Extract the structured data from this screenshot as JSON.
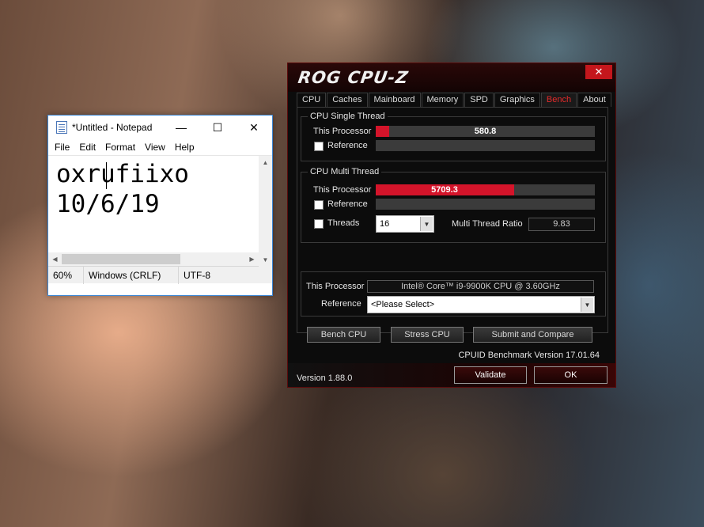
{
  "notepad": {
    "title": "*Untitled - Notepad",
    "window_controls": {
      "minimize": "—",
      "maximize": "☐",
      "close": "✕"
    },
    "menu": [
      "File",
      "Edit",
      "Format",
      "View",
      "Help"
    ],
    "content": "oxrufiixo\n10/6/19",
    "status": {
      "zoom": "60%",
      "line_ending": "Windows (CRLF)",
      "encoding": "UTF-8"
    }
  },
  "cpuz": {
    "title": "ROG CPU-Z",
    "close": "✕",
    "tabs": [
      "CPU",
      "Caches",
      "Mainboard",
      "Memory",
      "SPD",
      "Graphics",
      "Bench",
      "About"
    ],
    "active_tab": "Bench",
    "single_thread": {
      "group_label": "CPU Single Thread",
      "this_processor_label": "This Processor",
      "this_processor_value": "580.8",
      "this_processor_fraction": 0.06,
      "reference_label": "Reference"
    },
    "multi_thread": {
      "group_label": "CPU Multi Thread",
      "this_processor_label": "This Processor",
      "this_processor_value": "5709.3",
      "this_processor_fraction": 0.63,
      "reference_label": "Reference",
      "threads_label": "Threads",
      "threads_value": "16",
      "ratio_label": "Multi Thread Ratio",
      "ratio_value": "9.83"
    },
    "processor_section": {
      "this_processor_label": "This Processor",
      "this_processor_value": "Intel® Core™ i9-9900K CPU @ 3.60GHz",
      "reference_label": "Reference",
      "reference_value": "<Please Select>"
    },
    "buttons": {
      "bench": "Bench CPU",
      "stress": "Stress CPU",
      "submit": "Submit and Compare"
    },
    "benchmark_version": "CPUID Benchmark Version 17.01.64",
    "version": "Version 1.88.0",
    "validate": "Validate",
    "ok": "OK",
    "colors": {
      "accent": "#d4142a",
      "bar_bg": "#3b3b3b"
    }
  }
}
